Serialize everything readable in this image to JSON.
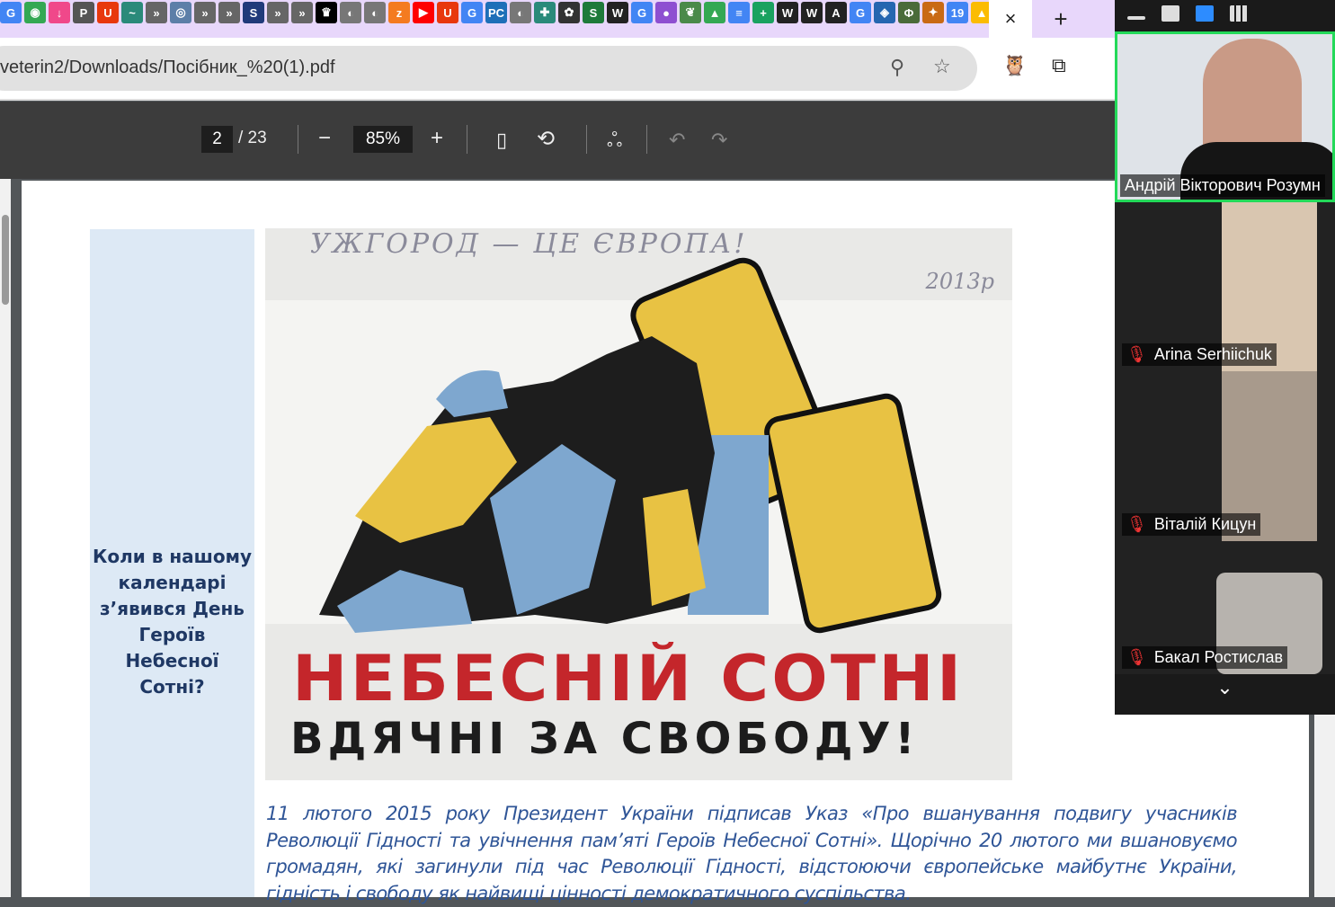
{
  "browser": {
    "bookmarks": [
      {
        "label": "G",
        "color": "#4285f4"
      },
      {
        "label": "◉",
        "color": "#34a853"
      },
      {
        "label": "↓",
        "color": "#f0488a"
      },
      {
        "label": "P",
        "color": "#555"
      },
      {
        "label": "U",
        "color": "#e8380d"
      },
      {
        "label": "~",
        "color": "#2a8a7a"
      },
      {
        "label": "»",
        "color": "#666"
      },
      {
        "label": "◎",
        "color": "#5c7fa8"
      },
      {
        "label": "»",
        "color": "#666"
      },
      {
        "label": "»",
        "color": "#666"
      },
      {
        "label": "S",
        "color": "#203a7a"
      },
      {
        "label": "»",
        "color": "#666"
      },
      {
        "label": "»",
        "color": "#666"
      },
      {
        "label": "♛",
        "color": "#000"
      },
      {
        "label": "◐",
        "color": "#777"
      },
      {
        "label": "◐",
        "color": "#777"
      },
      {
        "label": "z",
        "color": "#f47b20"
      },
      {
        "label": "▶",
        "color": "#f00"
      },
      {
        "label": "U",
        "color": "#e8380d"
      },
      {
        "label": "G",
        "color": "#4285f4"
      },
      {
        "label": "PC",
        "color": "#1e6fb8"
      },
      {
        "label": "◐",
        "color": "#777"
      },
      {
        "label": "✚",
        "color": "#2a8a7a"
      },
      {
        "label": "✿",
        "color": "#333"
      },
      {
        "label": "S",
        "color": "#1e7a3a"
      },
      {
        "label": "W",
        "color": "#222"
      },
      {
        "label": "G",
        "color": "#4285f4"
      },
      {
        "label": "●",
        "color": "#8e4fd1"
      },
      {
        "label": "❦",
        "color": "#4a8a4a"
      },
      {
        "label": "▲",
        "color": "#34a853"
      },
      {
        "label": "≡",
        "color": "#4285f4"
      },
      {
        "label": "+",
        "color": "#1aa260"
      },
      {
        "label": "W",
        "color": "#222"
      },
      {
        "label": "W",
        "color": "#222"
      },
      {
        "label": "A",
        "color": "#222"
      },
      {
        "label": "G",
        "color": "#4285f4"
      },
      {
        "label": "◈",
        "color": "#2566b0"
      },
      {
        "label": "Φ",
        "color": "#4a6b3a"
      },
      {
        "label": "✦",
        "color": "#c96a14"
      },
      {
        "label": "19",
        "color": "#4285f4"
      },
      {
        "label": "▲",
        "color": "#fbbc04"
      }
    ],
    "close_tab": "×",
    "new_tab": "+",
    "url": "veterin2/Downloads/Посібник_%20(1).pdf"
  },
  "pdf_toolbar": {
    "page": "2",
    "total": "/ 23",
    "zoom_out": "−",
    "zoom": "85%",
    "zoom_in": "+"
  },
  "document": {
    "sidebar_question": "Коли в нашому календарі з’явився День Героїв Небесної Сотні?",
    "poster": {
      "graffiti1": "УЖГОРОД — ЦЕ ЄВРОПА!",
      "graffiti2": "2013р",
      "headline": "НЕБЕСНІЙ СОТНІ",
      "subline": "ВДЯЧНІ ЗА СВОБОДУ!"
    },
    "paragraph": "11 лютого 2015 року Президент України підписав Указ «Про вшанування подвигу учасників Революції Гідності та увічнення пам’яті Героїв Небесної Сотні». Щорічно 20 лютого ми вшановуємо громадян, які загинули під час Революції Гідності, відстоюючи європейське майбутнє України, гідність і свободу як найвищі цінності демократичного суспільства."
  },
  "meeting": {
    "participants": [
      {
        "name": "Андрій Вікторович Розумн",
        "muted": false
      },
      {
        "name": "Arina Serhiichuk",
        "muted": true
      },
      {
        "name": "Віталій Кицун",
        "muted": true
      },
      {
        "name": "Бакал Ростислав",
        "muted": true
      }
    ],
    "more": "⌄"
  }
}
